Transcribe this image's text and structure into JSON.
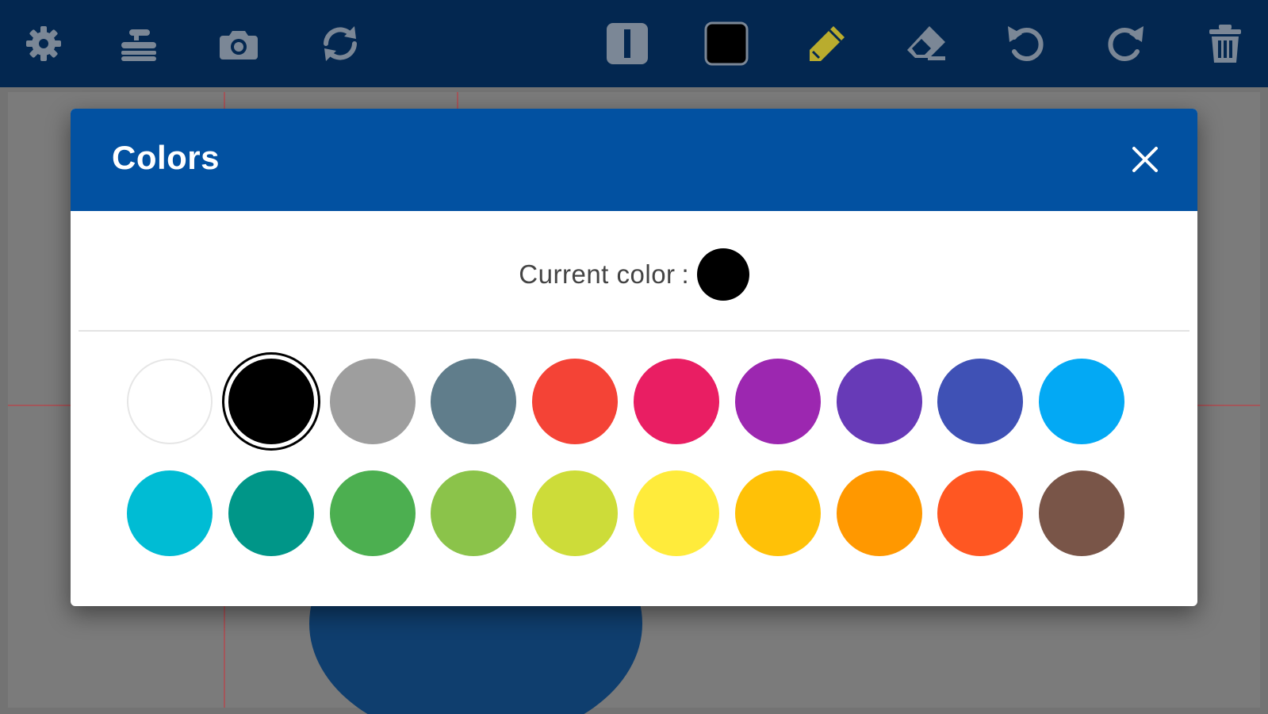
{
  "toolbar": {
    "left_icons": [
      "gear-icon",
      "curling-stone-icon",
      "camera-icon",
      "sync-icon"
    ],
    "right_icons": [
      "line-width-icon",
      "color-swatch-icon",
      "pencil-icon",
      "eraser-icon",
      "undo-icon",
      "redo-icon",
      "trash-icon"
    ],
    "current_tool": "pencil",
    "icon_color": "#7b8796",
    "pencil_color": "#b9ac2e",
    "bar_color": "#032750"
  },
  "modal": {
    "title": "Colors",
    "current_label": "Current color",
    "current_separator": ":",
    "current_color": "#000000",
    "header_color": "#0251a1",
    "selected_index": 1,
    "swatches": [
      [
        "#ffffff",
        "#000000",
        "#9e9e9e",
        "#607d8b",
        "#f44336",
        "#e91e63",
        "#9c27b0",
        "#673ab7",
        "#3f51b5",
        "#03a9f4"
      ],
      [
        "#00bcd4",
        "#009688",
        "#4caf50",
        "#8bc34a",
        "#cddc39",
        "#ffeb3b",
        "#ffc107",
        "#ff9800",
        "#ff5722",
        "#795548"
      ]
    ]
  }
}
